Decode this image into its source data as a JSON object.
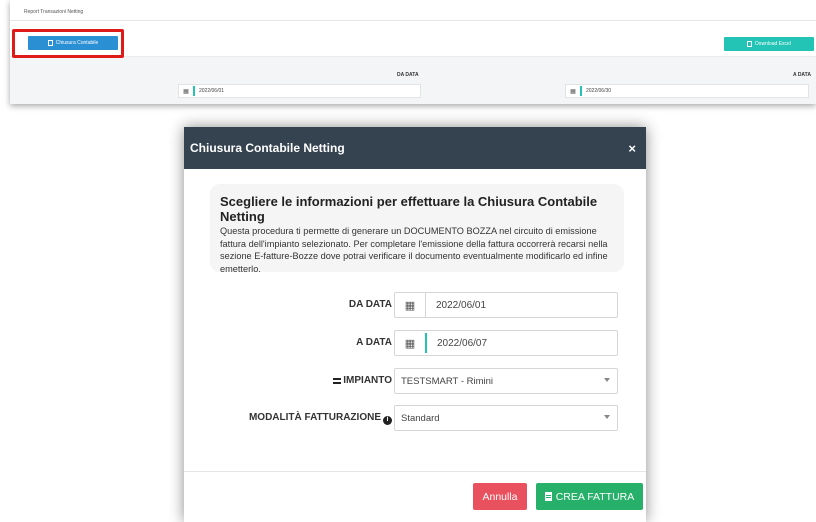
{
  "report": {
    "title": "Report Transazioni Netting",
    "chiusura_button": "Chiusura Contabile",
    "download_button": "Download Excel",
    "da_data_label": "DA DATA",
    "a_data_label": "A DATA",
    "da_data_value": "2022/06/01",
    "a_data_value": "2022/06/30"
  },
  "modal": {
    "title": "Chiusura Contabile Netting",
    "close_glyph": "×",
    "info_heading": "Scegliere le informazioni per effettuare la Chiusura Contabile Netting",
    "info_text": "Questa procedura ti permette di generare un DOCUMENTO BOZZA nel circuito di emissione fattura dell'impianto selezionato. Per completare l'emissione della fattura occorrerà recarsi nella sezione E-fatture-Bozze dove potrai verificare il documento eventualmente modificarlo ed infine emetterlo.",
    "form": {
      "da_data_label": "DA DATA",
      "da_data_value": "2022/06/01",
      "a_data_label": "A DATA",
      "a_data_value": "2022/06/07",
      "impianto_label": "IMPIANTO",
      "impianto_value": "TESTSMART - Rimini",
      "modalita_label": "MODALITÀ FATTURAZIONE",
      "modalita_value": "Standard"
    },
    "annulla_button": "Annulla",
    "crea_button": "CREA FATTURA"
  },
  "colors": {
    "header_bg": "#34434f",
    "primary_blue": "#2b8fd3",
    "teal": "#23c3b6",
    "danger": "#e8515d",
    "success": "#27b06a",
    "highlight_red": "#e01919"
  },
  "icons": {
    "calendar": "calendar-icon",
    "close": "close-icon",
    "impianto": "server-icon",
    "info": "info-circle-icon",
    "document": "file-icon"
  }
}
